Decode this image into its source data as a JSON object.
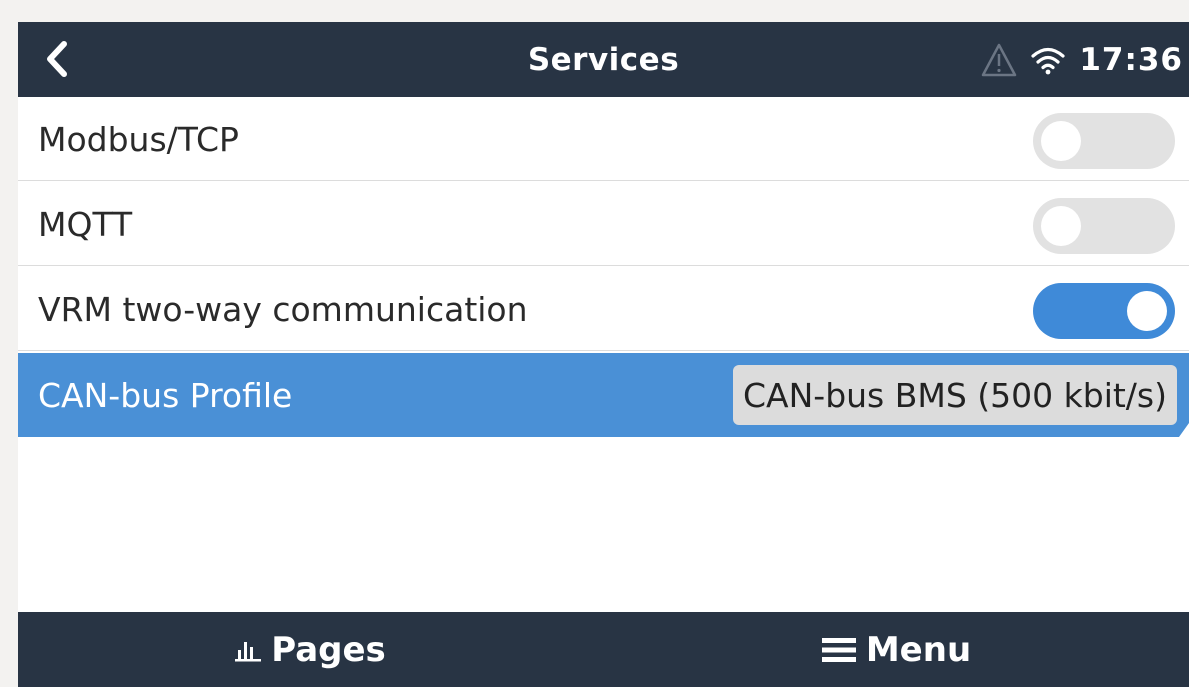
{
  "header": {
    "title": "Services",
    "time": "17:36",
    "back_icon": "chevron-left-icon",
    "alert_icon": "warning-triangle-icon",
    "wifi_icon": "wifi-icon"
  },
  "services": {
    "items": [
      {
        "label": "Modbus/TCP",
        "control": "toggle",
        "state": "off"
      },
      {
        "label": "MQTT",
        "control": "toggle",
        "state": "off"
      },
      {
        "label": "VRM two-way communication",
        "control": "toggle",
        "state": "on"
      },
      {
        "label": "CAN-bus Profile",
        "control": "value",
        "value": "CAN-bus BMS (500 kbit/s)",
        "selected": true
      }
    ]
  },
  "footer": {
    "pages_label": "Pages",
    "pages_icon": "bar-chart-icon",
    "menu_label": "Menu",
    "menu_icon": "hamburger-menu-icon"
  },
  "colors": {
    "header_bg": "#283444",
    "selected_row_bg": "#4a90d6",
    "toggle_on": "#3f8ad8",
    "toggle_off": "#e2e2e2"
  }
}
